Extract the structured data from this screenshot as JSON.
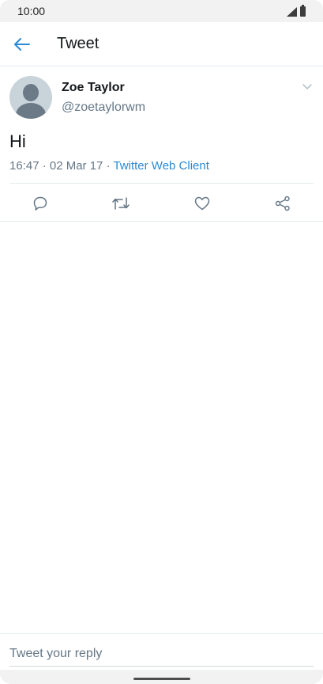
{
  "status_bar": {
    "time": "10:00",
    "signal_icon": "cellular-signal-icon",
    "battery_icon": "battery-icon"
  },
  "app_bar": {
    "back_icon": "arrow-left-icon",
    "title": "Tweet"
  },
  "tweet": {
    "author": {
      "display_name": "Zoe Taylor",
      "handle": "@zoetaylorwm",
      "avatar_icon": "default-avatar-icon"
    },
    "menu_icon": "chevron-down-icon",
    "text": "Hi",
    "timestamp": "16:47 · 02 Mar 17 · ",
    "source": "Twitter Web Client",
    "actions": [
      {
        "name": "reply",
        "icon": "reply-bubble-icon"
      },
      {
        "name": "retweet",
        "icon": "retweet-icon"
      },
      {
        "name": "like",
        "icon": "heart-icon"
      },
      {
        "name": "share",
        "icon": "share-icon"
      }
    ]
  },
  "reply_bar": {
    "placeholder": "Tweet your reply",
    "value": ""
  },
  "colors": {
    "accent": "#2b8ad1",
    "secondary_text": "#657786",
    "divider": "#e6ecf0"
  }
}
